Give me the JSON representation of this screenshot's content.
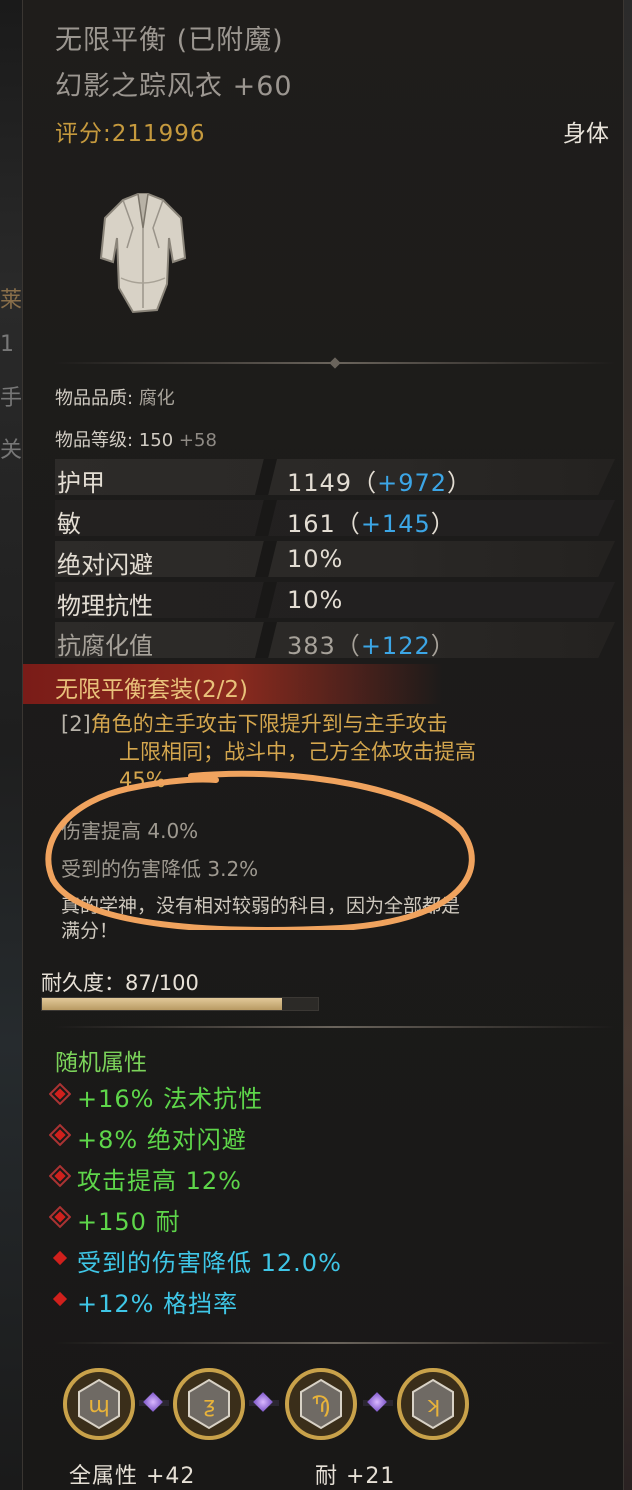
{
  "item": {
    "title_line1": "无限平衡 (已附魔)",
    "title_line2": "幻影之踪风衣 +60",
    "score": "评分:211996",
    "slot": "身体",
    "quality_label": "物品品质:",
    "quality_value": "腐化",
    "level_label": "物品等级:",
    "level_value": "150",
    "level_bonus": "+58"
  },
  "stats": [
    {
      "label": "护甲",
      "value": "1149（",
      "bonus": "+972",
      "close": "）"
    },
    {
      "label": "敏",
      "value": "161（",
      "bonus": "+145",
      "close": "）"
    },
    {
      "label": "绝对闪避",
      "value": "10%",
      "bonus": "",
      "close": ""
    },
    {
      "label": "物理抗性",
      "value": "10%",
      "bonus": "",
      "close": ""
    },
    {
      "label": "抗腐化值",
      "value": "383（",
      "bonus": "+122",
      "close": "）"
    }
  ],
  "set": {
    "name": "无限平衡套装(2/2)",
    "tag": "[2]",
    "desc_line1": "角色的主手攻击下限提升到与主手攻击",
    "desc_line2": "上限相同；战斗中，己方全体攻击提高",
    "desc_line3": "45%",
    "bonus1": "伤害提高 4.0%",
    "bonus2": "受到的伤害降低 3.2%"
  },
  "flavor": {
    "line1": "真的学神，没有相对较弱的科目，因为全部都是",
    "line2": "满分！"
  },
  "durability": {
    "label": "耐久度：87/100",
    "fraction": 0.87
  },
  "random_attrs": {
    "title": "随机属性",
    "items": [
      {
        "text": "+16% 法术抗性",
        "color": "#5ed64a",
        "icon": "diamond-frame-icon"
      },
      {
        "text": "+8% 绝对闪避",
        "color": "#5ed64a",
        "icon": "diamond-frame-icon"
      },
      {
        "text": "攻击提高 12%",
        "color": "#5ed64a",
        "icon": "diamond-frame-icon"
      },
      {
        "text": "+150 耐",
        "color": "#5ed64a",
        "icon": "diamond-frame-icon"
      },
      {
        "text": "受到的伤害降低 12.0%",
        "color": "#3fc6e6",
        "icon": "red-diamond-icon"
      },
      {
        "text": "+12% 格挡率",
        "color": "#3fc6e6",
        "icon": "red-diamond-icon"
      }
    ]
  },
  "gems": {
    "stat1": "全属性 +42",
    "stat2": "耐 +21"
  },
  "colors": {
    "score": "#c69a3e",
    "set_bar": "#8c2a1e",
    "blue_bonus": "#3ca6e6",
    "green_attr": "#5ed64a",
    "annotation_circle": "#f0a35e"
  }
}
